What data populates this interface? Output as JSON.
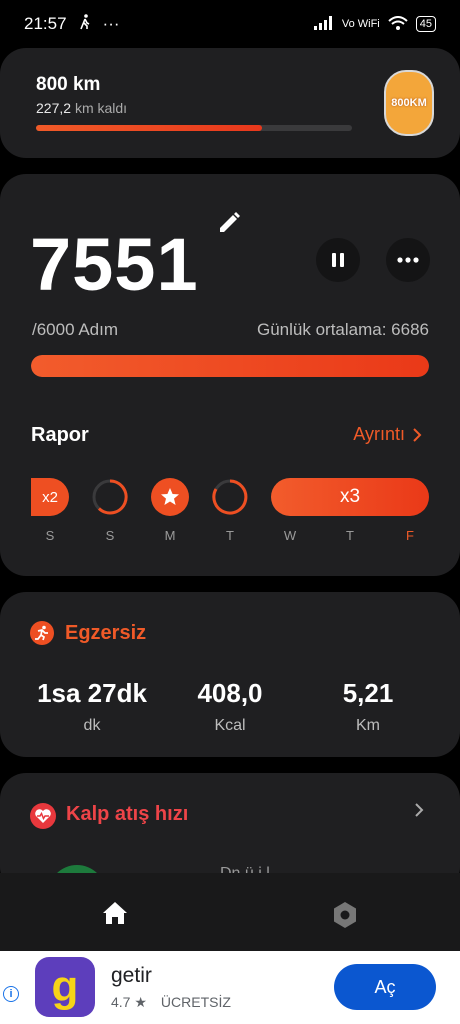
{
  "status": {
    "time": "21:57",
    "network": "Vo WiFi",
    "battery": "45"
  },
  "goal": {
    "title": "800 km",
    "remaining_value": "227,2",
    "remaining_suffix": "km kaldı",
    "progress": 0.716,
    "badge": "800KM"
  },
  "steps": {
    "count": "7551",
    "goal_text": "/6000 Adım",
    "average_text": "Günlük ortalama: 6686",
    "progress": 1.0
  },
  "report": {
    "title": "Rapor",
    "detail_label": "Ayrıntı",
    "x2_label": "x2",
    "x3_label": "x3",
    "days": [
      "S",
      "S",
      "M",
      "T",
      "W",
      "T",
      "F"
    ]
  },
  "exercise": {
    "title": "Egzersiz",
    "metrics": [
      {
        "value": "1sa 27dk",
        "unit": "dk"
      },
      {
        "value": "408,0",
        "unit": "Kcal"
      },
      {
        "value": "5,21",
        "unit": "Km"
      }
    ]
  },
  "heart": {
    "title": "Kalp atış hızı",
    "preview": "Dn ü   i   l"
  },
  "ad": {
    "app_name": "getir",
    "rating": "4.7",
    "price": "ÜCRETSİZ",
    "button": "Aç",
    "logo_char": "g",
    "info": "i"
  },
  "colors": {
    "accent": "#f05a28",
    "heart": "#ee4448",
    "card": "#1f1f21",
    "ad_button": "#0b57d0"
  }
}
